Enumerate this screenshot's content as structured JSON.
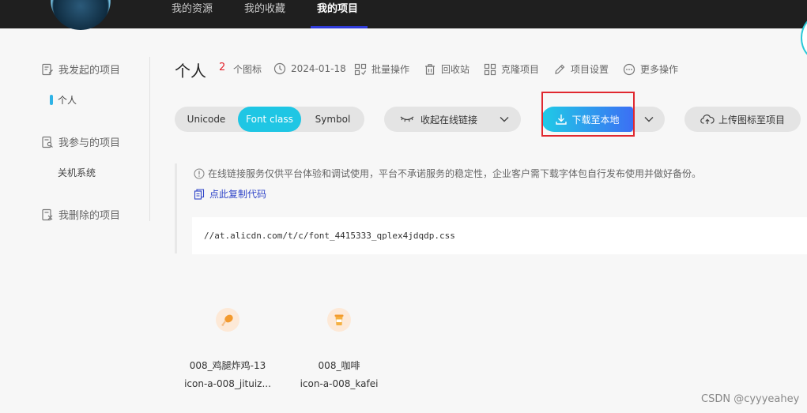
{
  "nav": {
    "items": [
      "我的资源",
      "我的收藏",
      "我的项目"
    ],
    "active_index": 2
  },
  "sidebar": {
    "groups": [
      {
        "label": "我发起的项目",
        "icon": "edit-doc-icon",
        "children": [
          "个人"
        ]
      },
      {
        "label": "我参与的项目",
        "icon": "search-doc-icon",
        "children": [
          "关机系统"
        ]
      },
      {
        "label": "我删除的项目",
        "icon": "delete-doc-icon",
        "children": []
      }
    ]
  },
  "project": {
    "title": "个人",
    "icon_count": "2",
    "icon_count_label": "个图标",
    "date": "2024-01-18",
    "actions": {
      "batch": "批量操作",
      "recycle": "回收站",
      "clone": "克隆项目",
      "settings": "项目设置",
      "more": "更多操作"
    }
  },
  "format_tabs": [
    "Unicode",
    "Font class",
    "Symbol"
  ],
  "format_active": "Font class",
  "buttons": {
    "collapse_link": "收起在线链接",
    "download": "下载至本地",
    "upload": "上传图标至项目"
  },
  "notice": {
    "text": "在线链接服务仅供平台体验和调试使用，平台不承诺服务的稳定性，企业客户需下载字体包自行发布使用并做好备份。",
    "copy_code": "点此复制代码"
  },
  "code_url": "//at.alicdn.com/t/c/font_4415333_qplex4jdqdp.css",
  "icons": [
    {
      "name": "008_鸡腿炸鸡-13",
      "class": "icon-a-008_jituiz...",
      "icon": "fried-chicken-icon"
    },
    {
      "name": "008_咖啡",
      "class": "icon-a-008_kafei",
      "icon": "coffee-cup-icon"
    }
  ],
  "watermark": "CSDN @cyyyeahey",
  "colors": {
    "accent": "#1fc6e4",
    "download_gradient_end": "#3c6ff4",
    "count_red": "#e3232d",
    "highlight_box": "#e0282f",
    "link_blue": "#2f44c8"
  }
}
